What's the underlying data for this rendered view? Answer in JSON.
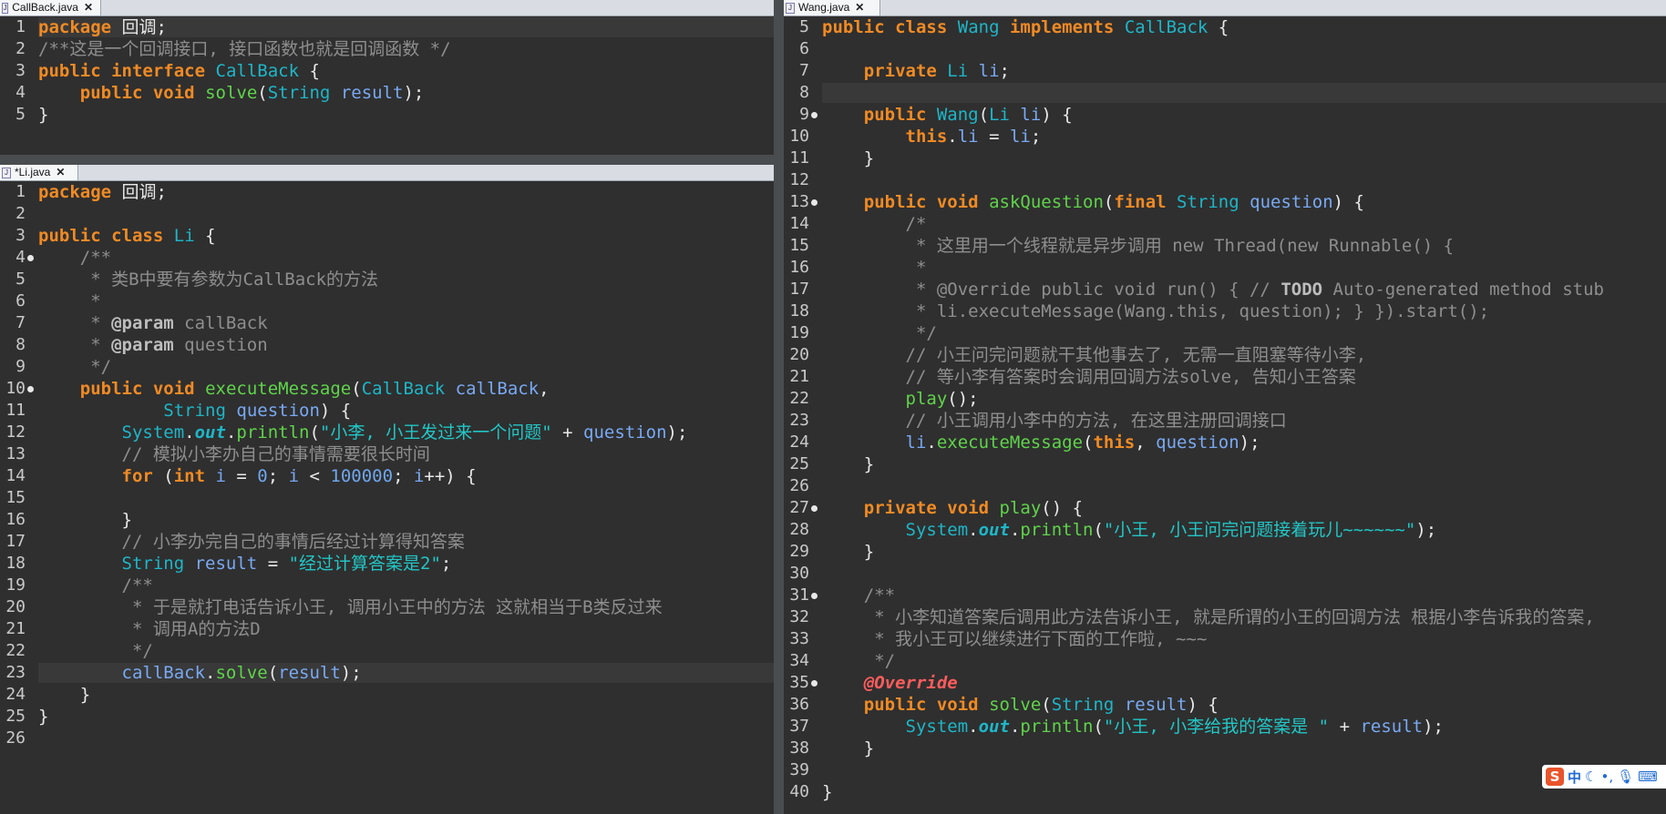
{
  "colors": {
    "background": "#2f2f2f",
    "keyword": "#f08a24",
    "type": "#1eb6c8",
    "string": "#22c6c6",
    "comment": "#8e8e8e",
    "method": "#5fd44a"
  },
  "tabs": {
    "callback": "CallBack.java",
    "li": "*Li.java",
    "wang": "Wang.java"
  },
  "callback_lines": [
    {
      "n": "1",
      "t": "package 回调;"
    },
    {
      "n": "2",
      "t": "/**这是一个回调接口, 接口函数也就是回调函数 */"
    },
    {
      "n": "3",
      "t": "public interface CallBack {"
    },
    {
      "n": "4",
      "t": "    public void solve(String result);"
    },
    {
      "n": "5",
      "t": "}"
    }
  ],
  "li_lines": [
    {
      "n": "1",
      "t": "package 回调;"
    },
    {
      "n": "2",
      "t": ""
    },
    {
      "n": "3",
      "t": "public class Li {"
    },
    {
      "n": "4",
      "t": "    /**"
    },
    {
      "n": "5",
      "t": "     * 类B中要有参数为CallBack的方法"
    },
    {
      "n": "6",
      "t": "     *"
    },
    {
      "n": "7",
      "t": "     * @param callBack"
    },
    {
      "n": "8",
      "t": "     * @param question"
    },
    {
      "n": "9",
      "t": "     */"
    },
    {
      "n": "10",
      "t": "    public void executeMessage(CallBack callBack,"
    },
    {
      "n": "11",
      "t": "            String question) {"
    },
    {
      "n": "12",
      "t": "        System.out.println(\"小李, 小王发过来一个问题\" + question);"
    },
    {
      "n": "13",
      "t": "        // 模拟小李办自己的事情需要很长时间"
    },
    {
      "n": "14",
      "t": "        for (int i = 0; i < 100000; i++) {"
    },
    {
      "n": "15",
      "t": ""
    },
    {
      "n": "16",
      "t": "        }"
    },
    {
      "n": "17",
      "t": "        // 小李办完自己的事情后经过计算得知答案"
    },
    {
      "n": "18",
      "t": "        String result = \"经过计算答案是2\";"
    },
    {
      "n": "19",
      "t": "        /**"
    },
    {
      "n": "20",
      "t": "         * 于是就打电话告诉小王, 调用小王中的方法 这就相当于B类反过来"
    },
    {
      "n": "21",
      "t": "         * 调用A的方法D"
    },
    {
      "n": "22",
      "t": "         */"
    },
    {
      "n": "23",
      "t": "        callBack.solve(result);"
    },
    {
      "n": "24",
      "t": "    }"
    },
    {
      "n": "25",
      "t": "}"
    },
    {
      "n": "26",
      "t": ""
    }
  ],
  "wang_lines": [
    {
      "n": "5",
      "t": "public class Wang implements CallBack {"
    },
    {
      "n": "6",
      "t": ""
    },
    {
      "n": "7",
      "t": "    private Li li;"
    },
    {
      "n": "8",
      "t": ""
    },
    {
      "n": "9",
      "t": "    public Wang(Li li) {"
    },
    {
      "n": "10",
      "t": "        this.li = li;"
    },
    {
      "n": "11",
      "t": "    }"
    },
    {
      "n": "12",
      "t": ""
    },
    {
      "n": "13",
      "t": "    public void askQuestion(final String question) {"
    },
    {
      "n": "14",
      "t": "        /*"
    },
    {
      "n": "15",
      "t": "         * 这里用一个线程就是异步调用 new Thread(new Runnable() {"
    },
    {
      "n": "16",
      "t": "         *"
    },
    {
      "n": "17",
      "t": "         * @Override public void run() { // TODO Auto-generated method stub"
    },
    {
      "n": "18",
      "t": "         * li.executeMessage(Wang.this, question); } }).start();"
    },
    {
      "n": "19",
      "t": "         */"
    },
    {
      "n": "20",
      "t": "        // 小王问完问题就干其他事去了, 无需一直阻塞等待小李,"
    },
    {
      "n": "21",
      "t": "        // 等小李有答案时会调用回调方法solve, 告知小王答案"
    },
    {
      "n": "22",
      "t": "        play();"
    },
    {
      "n": "23",
      "t": "        // 小王调用小李中的方法, 在这里注册回调接口"
    },
    {
      "n": "24",
      "t": "        li.executeMessage(this, question);"
    },
    {
      "n": "25",
      "t": "    }"
    },
    {
      "n": "26",
      "t": ""
    },
    {
      "n": "27",
      "t": "    private void play() {"
    },
    {
      "n": "28",
      "t": "        System.out.println(\"小王, 小王问完问题接着玩儿~~~~~~\");"
    },
    {
      "n": "29",
      "t": "    }"
    },
    {
      "n": "30",
      "t": ""
    },
    {
      "n": "31",
      "t": "    /**"
    },
    {
      "n": "32",
      "t": "     * 小李知道答案后调用此方法告诉小王, 就是所谓的小王的回调方法 根据小李告诉我的答案,"
    },
    {
      "n": "33",
      "t": "     * 我小王可以继续进行下面的工作啦, ~~~"
    },
    {
      "n": "34",
      "t": "     */"
    },
    {
      "n": "35",
      "t": "    @Override"
    },
    {
      "n": "36",
      "t": "    public void solve(String result) {"
    },
    {
      "n": "37",
      "t": "        System.out.println(\"小王, 小李给我的答案是 \" + result);"
    },
    {
      "n": "38",
      "t": "    }"
    },
    {
      "n": "39",
      "t": ""
    },
    {
      "n": "40",
      "t": "}"
    }
  ],
  "ime": {
    "label": "中"
  }
}
